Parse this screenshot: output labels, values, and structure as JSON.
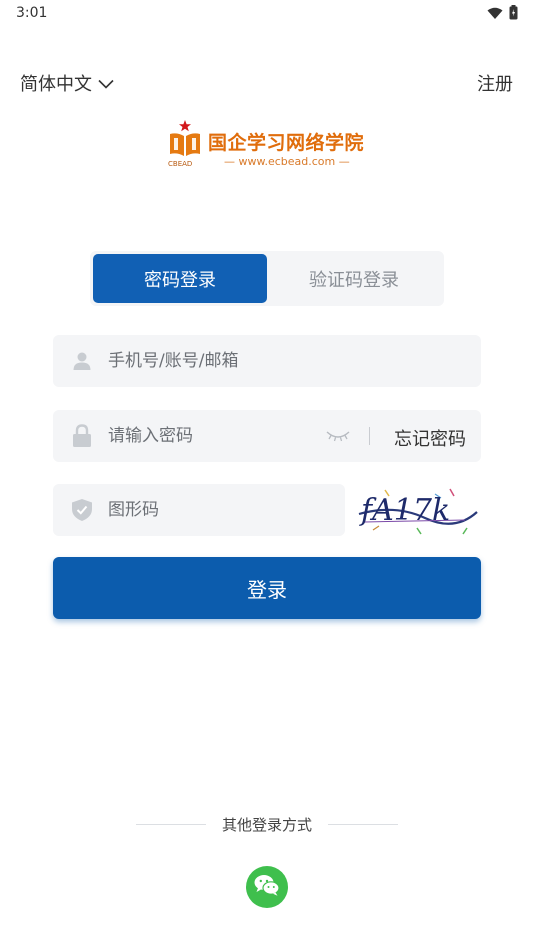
{
  "status_bar": {
    "time": "3:01"
  },
  "header": {
    "language": "简体中文",
    "register": "注册"
  },
  "logo": {
    "name": "国企学习网络学院",
    "url": "— www.ecbead.com —",
    "abbr": "CBEAD"
  },
  "tabs": [
    {
      "label": "密码登录",
      "active": true
    },
    {
      "label": "验证码登录",
      "active": false
    }
  ],
  "form": {
    "phone_placeholder": "手机号/账号/邮箱",
    "password_placeholder": "请输入密码",
    "forgot_password": "忘记密码",
    "captcha_placeholder": "图形码",
    "captcha_text": "fA17k",
    "login_label": "登录"
  },
  "other_login": {
    "label": "其他登录方式"
  },
  "colors": {
    "primary": "#0c5cad",
    "brand_orange": "#e06d0c",
    "wechat": "#3fbf4d"
  }
}
